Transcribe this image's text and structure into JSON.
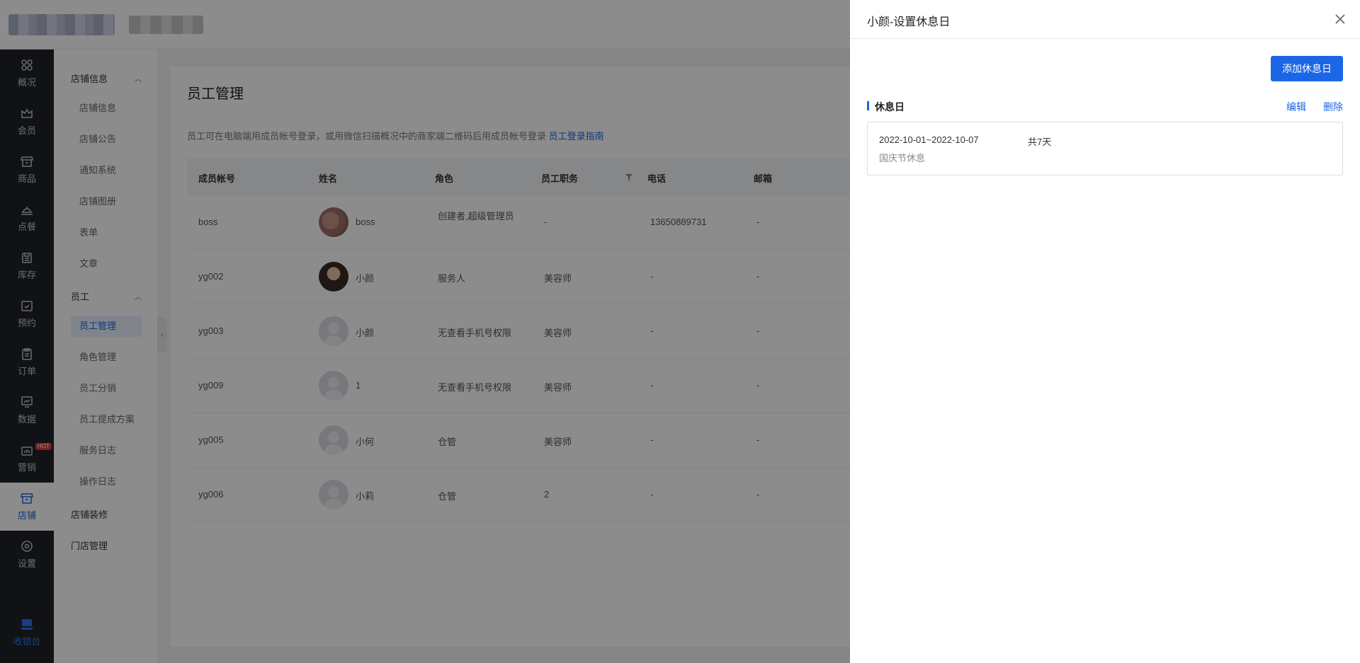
{
  "sidebar": {
    "items": [
      {
        "label": "概况",
        "icon": "grid-icon"
      },
      {
        "label": "会员",
        "icon": "crown-icon"
      },
      {
        "label": "商品",
        "icon": "store-icon"
      },
      {
        "label": "点餐",
        "icon": "dish-icon"
      },
      {
        "label": "库存",
        "icon": "box-icon"
      },
      {
        "label": "预约",
        "icon": "calendar-check-icon"
      },
      {
        "label": "订单",
        "icon": "clipboard-icon"
      },
      {
        "label": "数据",
        "icon": "chart-monitor-icon"
      },
      {
        "label": "营销",
        "icon": "bar-chart-icon",
        "badge": "HOT"
      },
      {
        "label": "店铺",
        "icon": "shop-icon"
      },
      {
        "label": "设置",
        "icon": "gear-icon"
      }
    ],
    "cashier": {
      "label": "收银台",
      "icon": "cashier-icon"
    }
  },
  "subnav": {
    "group1": "店铺信息",
    "group1_items": [
      "店铺信息",
      "店铺公告",
      "通知系统",
      "店铺图册",
      "表单",
      "文章"
    ],
    "group2": "员工",
    "group2_items": [
      "员工管理",
      "角色管理",
      "员工分销",
      "员工提成方案",
      "服务日志",
      "操作日志"
    ],
    "group3": "店铺装修",
    "group4": "门店管理"
  },
  "main": {
    "title": "员工管理",
    "notice": "员工可在电脑端用成员帐号登录，或用微信扫描概况中的商家端二维码后用成员帐号登录",
    "notice_link": "员工登录指南",
    "columns": [
      "成员帐号",
      "姓名",
      "角色",
      "员工职务",
      "电话",
      "邮箱"
    ],
    "rows": [
      {
        "account": "boss",
        "name": "boss",
        "role": "创建者,超级管理员",
        "position": "-",
        "phone": "13650889731",
        "email": "-"
      },
      {
        "account": "yg002",
        "name": "小颜",
        "role": "服务人",
        "position": "美容师",
        "phone": "-",
        "email": "-"
      },
      {
        "account": "yg003",
        "name": "小颜",
        "role": "无查看手机号权限",
        "position": "美容师",
        "phone": "-",
        "email": "-"
      },
      {
        "account": "yg009",
        "name": "1",
        "role": "无查看手机号权限",
        "position": "美容师",
        "phone": "-",
        "email": "-"
      },
      {
        "account": "yg005",
        "name": "小何",
        "role": "仓管",
        "position": "美容师",
        "phone": "-",
        "email": "-"
      },
      {
        "account": "yg006",
        "name": "小莉",
        "role": "仓管",
        "position": "2",
        "phone": "-",
        "email": "-"
      }
    ]
  },
  "drawer": {
    "title": "小颜-设置休息日",
    "add_button": "添加休息日",
    "section_title": "休息日",
    "edit_link": "编辑",
    "delete_link": "删除",
    "rest_days": [
      {
        "range": "2022-10-01~2022-10-07",
        "total": "共7天",
        "note": "国庆节休息"
      }
    ]
  },
  "colors": {
    "accent": "#1a66e6",
    "sidebar_bg": "#1f2227",
    "hot": "#e53935"
  }
}
